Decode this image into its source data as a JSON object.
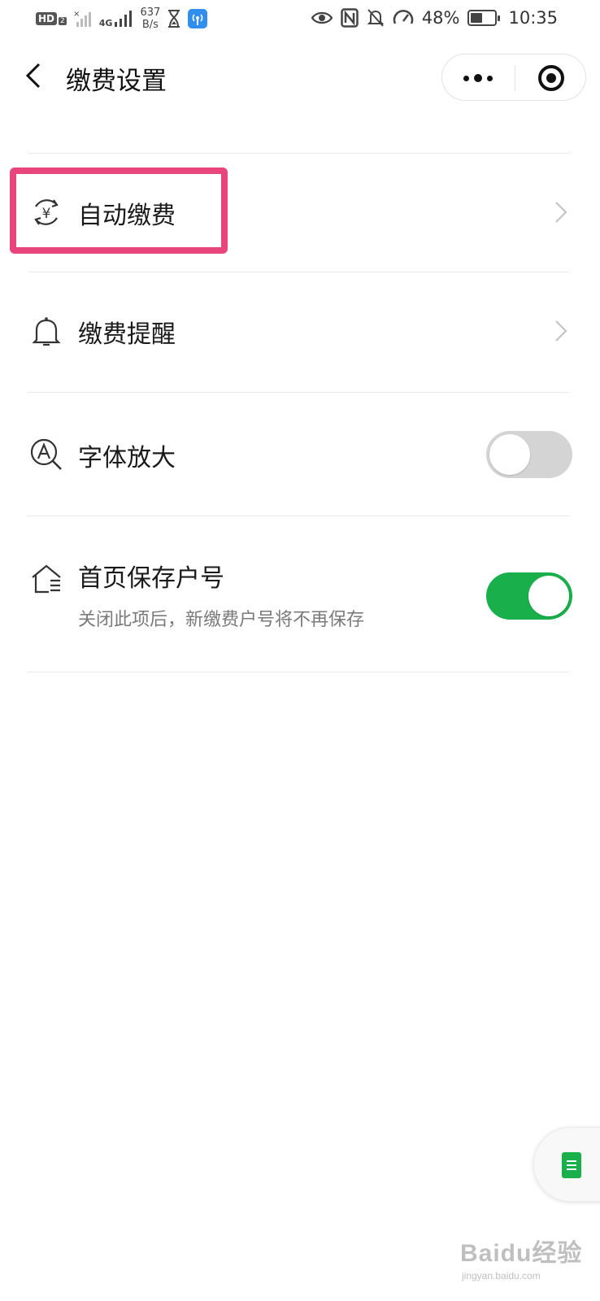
{
  "status_bar": {
    "hd_label": "HD",
    "hd_sub": "2",
    "network_type": "4G",
    "speed_value": "637",
    "speed_unit": "B/s",
    "battery": "48%",
    "time": "10:35"
  },
  "nav": {
    "title": "缴费设置"
  },
  "settings": {
    "items": [
      {
        "label": "自动缴费",
        "icon": "auto-pay-yuan-icon",
        "control": "chevron"
      },
      {
        "label": "缴费提醒",
        "icon": "bell-icon",
        "control": "chevron"
      },
      {
        "label": "字体放大",
        "icon": "font-zoom-icon",
        "control": "toggle",
        "enabled": false
      },
      {
        "label": "首页保存户号",
        "sub": "关闭此项后，新缴费户号将不再保存",
        "icon": "house-list-icon",
        "control": "toggle",
        "enabled": true
      }
    ]
  },
  "colors": {
    "toggle_on": "#19b04b",
    "toggle_off": "#d4d4d4",
    "highlight": "#e8457c"
  },
  "watermark": {
    "main": "Baidu经验",
    "sub": "jingyan.baidu.com"
  }
}
